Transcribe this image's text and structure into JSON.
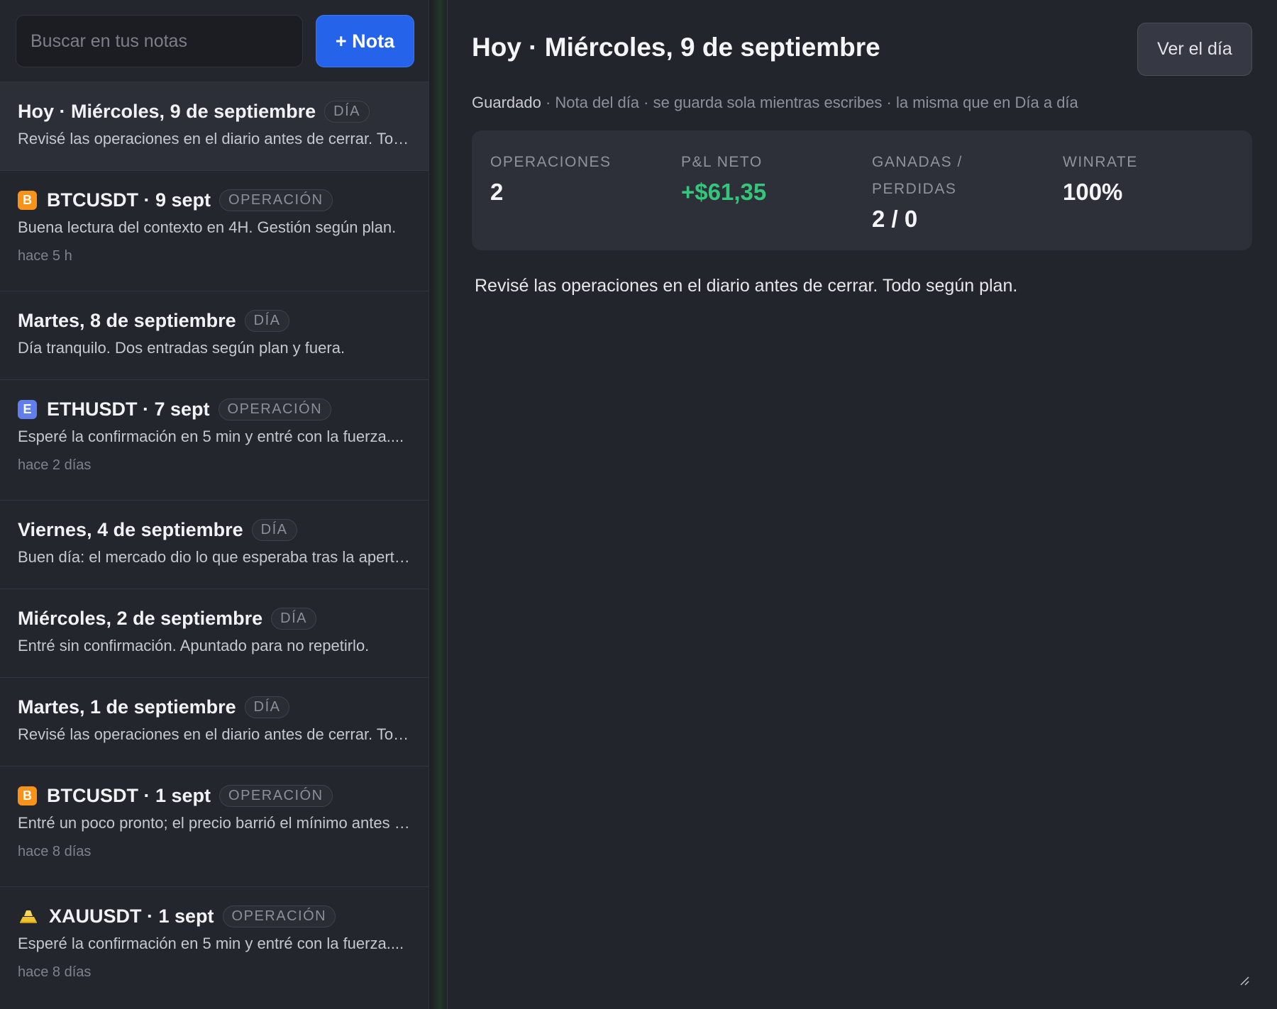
{
  "search": {
    "placeholder": "Buscar en tus notas"
  },
  "new_note_label": "+ Nota",
  "notes": [
    {
      "title": "Hoy · Miércoles, 9 de septiembre",
      "badge": "DÍA",
      "preview": "Revisé las operaciones en el diario antes de cerrar. Todo según plan."
    },
    {
      "symbol_icon": "B",
      "title": "BTCUSDT · 9 sept",
      "badge": "OPERACIÓN",
      "preview": "Buena lectura del contexto en 4H. Gestión según plan.",
      "time": "hace 5 h"
    },
    {
      "title": "Martes, 8 de septiembre",
      "badge": "DÍA",
      "preview": "Día tranquilo. Dos entradas según plan y fuera."
    },
    {
      "symbol_icon": "E",
      "title": "ETHUSDT · 7 sept",
      "badge": "OPERACIÓN",
      "preview": "Esperé la confirmación en 5 min y entré con la fuerza....",
      "time": "hace 2 días"
    },
    {
      "title": "Viernes, 4 de septiembre",
      "badge": "DÍA",
      "preview": "Buen día: el mercado dio lo que esperaba tras la apertura."
    },
    {
      "title": "Miércoles, 2 de septiembre",
      "badge": "DÍA",
      "preview": "Entré sin confirmación. Apuntado para no repetirlo."
    },
    {
      "title": "Martes, 1 de septiembre",
      "badge": "DÍA",
      "preview": "Revisé las operaciones en el diario antes de cerrar. Todo según plan."
    },
    {
      "symbol_icon": "B",
      "title": "BTCUSDT · 1 sept",
      "badge": "OPERACIÓN",
      "preview": "Entré un poco pronto; el precio barrió el mínimo antes de girar.",
      "time": "hace 8 días"
    },
    {
      "title": "XAUUSDT · 1 sept",
      "badge": "OPERACIÓN",
      "preview": "Esperé la confirmación en 5 min y entré con la fuerza....",
      "time": "hace 8 días"
    }
  ],
  "detail": {
    "title": "Hoy · Miércoles, 9 de septiembre",
    "view_day_label": "Ver el día",
    "status_saved": "Guardado",
    "status_rest": " · Nota del día · se guarda sola mientras escribes · la misma que en Día a día",
    "stats": [
      {
        "label": "OPERACIONES",
        "value": "2"
      },
      {
        "label": "P&L NETO",
        "value": "+$61,35"
      },
      {
        "label": "GANADAS / PERDIDAS",
        "value": "2 / 0"
      },
      {
        "label": "WINRATE",
        "value": "100%"
      }
    ],
    "body": "Revisé las operaciones en el diario antes de cerrar. Todo según plan."
  },
  "colors": {
    "accent": "#2563eb",
    "positive": "#34c77b",
    "btc": "#f7931a",
    "eth": "#627eea",
    "gold": "#f2c230"
  },
  "icons": {
    "btc": "bitcoin-icon",
    "eth": "ethereum-icon",
    "gold": "gold-bars-icon",
    "resize": "resize-handle-icon"
  }
}
